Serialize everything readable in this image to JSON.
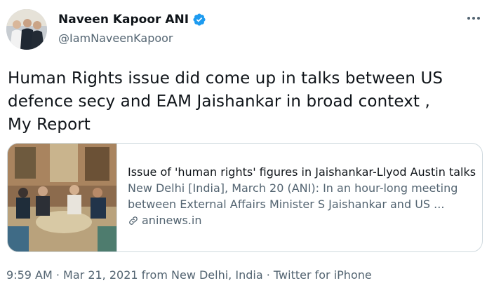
{
  "author": {
    "name": "Naveen Kapoor ANI",
    "handle": "@IamNaveenKapoor",
    "verified_icon": "verified-badge-icon"
  },
  "tweet": {
    "text_lines": [
      "Human Rights issue did come up in talks between US",
      "defence secy and EAM Jaishankar in broad context  ,",
      "My Report"
    ]
  },
  "card": {
    "title": "Issue of 'human rights' figures in Jaishankar-Llyod Austin talks",
    "description_lines": [
      "New Delhi [India], March 20 (ANI): In an hour-long meeting",
      "between External Affairs Minister S Jaishankar and US ..."
    ],
    "domain": "aninews.in",
    "link_icon": "link-icon"
  },
  "meta": {
    "time": "9:59 AM",
    "date": "Mar 21, 2021",
    "location_prefix": "from",
    "location": "New Delhi, India",
    "source": "Twitter for iPhone",
    "separator": "·"
  },
  "colors": {
    "text_primary": "#0f1419",
    "text_secondary": "#536471",
    "verified_blue": "#1d9bf0",
    "border": "#cfd9de"
  }
}
